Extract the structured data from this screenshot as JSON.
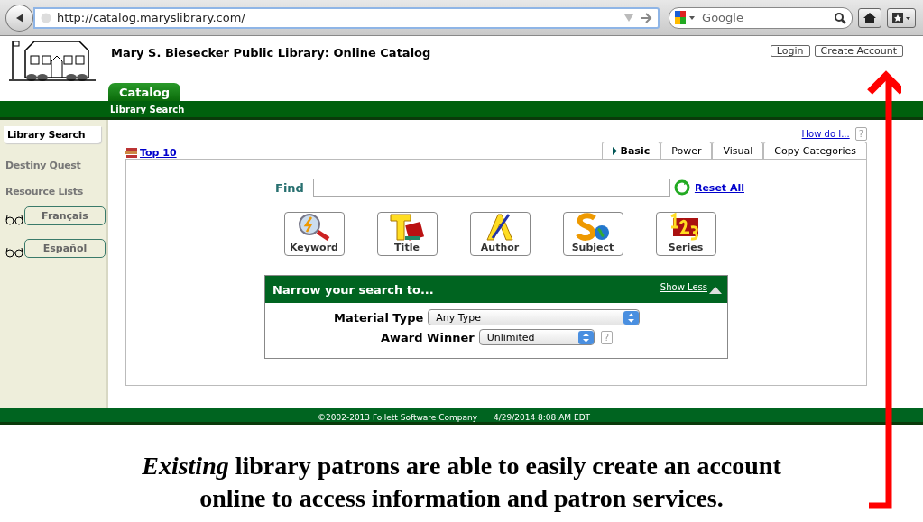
{
  "browser": {
    "url": "http://catalog.maryslibrary.com/",
    "search_placeholder": "Google"
  },
  "header": {
    "title": "Mary S. Biesecker Public Library: Online Catalog",
    "buttons": [
      "Login",
      "Create Account"
    ]
  },
  "nav_tabs": [
    {
      "label": "Catalog",
      "selected": true
    }
  ],
  "subnav": [
    {
      "label": "Library Search",
      "selected": true
    }
  ],
  "sidebar": {
    "items": [
      {
        "label": "Library Search",
        "kind": "tab",
        "selected": true
      },
      {
        "label": "Destiny Quest",
        "kind": "tab",
        "selected": false
      },
      {
        "label": "Resource Lists",
        "kind": "tab",
        "selected": false
      },
      {
        "label": "Français",
        "kind": "language"
      },
      {
        "label": "Español",
        "kind": "language"
      }
    ]
  },
  "help": {
    "link": "How do I...",
    "icon": "?"
  },
  "top10": "Top 10",
  "search_tabs": [
    {
      "label": "Basic",
      "selected": true
    },
    {
      "label": "Power",
      "selected": false
    },
    {
      "label": "Visual",
      "selected": false
    },
    {
      "label": "Copy Categories",
      "selected": false
    }
  ],
  "find": {
    "label": "Find",
    "reset": "Reset All"
  },
  "search_buttons": [
    {
      "label": "Keyword",
      "kind": "keyword"
    },
    {
      "label": "Title",
      "kind": "title"
    },
    {
      "label": "Author",
      "kind": "author"
    },
    {
      "label": "Subject",
      "kind": "subject"
    },
    {
      "label": "Series",
      "kind": "series"
    }
  ],
  "narrow": {
    "title": "Narrow your search to...",
    "toggle": "Show Less",
    "fields": [
      {
        "label": "Material Type",
        "value": "Any Type"
      },
      {
        "label": "Award Winner",
        "value": "Unlimited",
        "help": "?"
      }
    ]
  },
  "footer": {
    "copyright": "©2002-2013  Follett Software Company",
    "timestamp": "4/29/2014 8:08 AM EDT"
  },
  "caption": "*Existing* library patrons are able to easily create an account online to access information and patron services."
}
